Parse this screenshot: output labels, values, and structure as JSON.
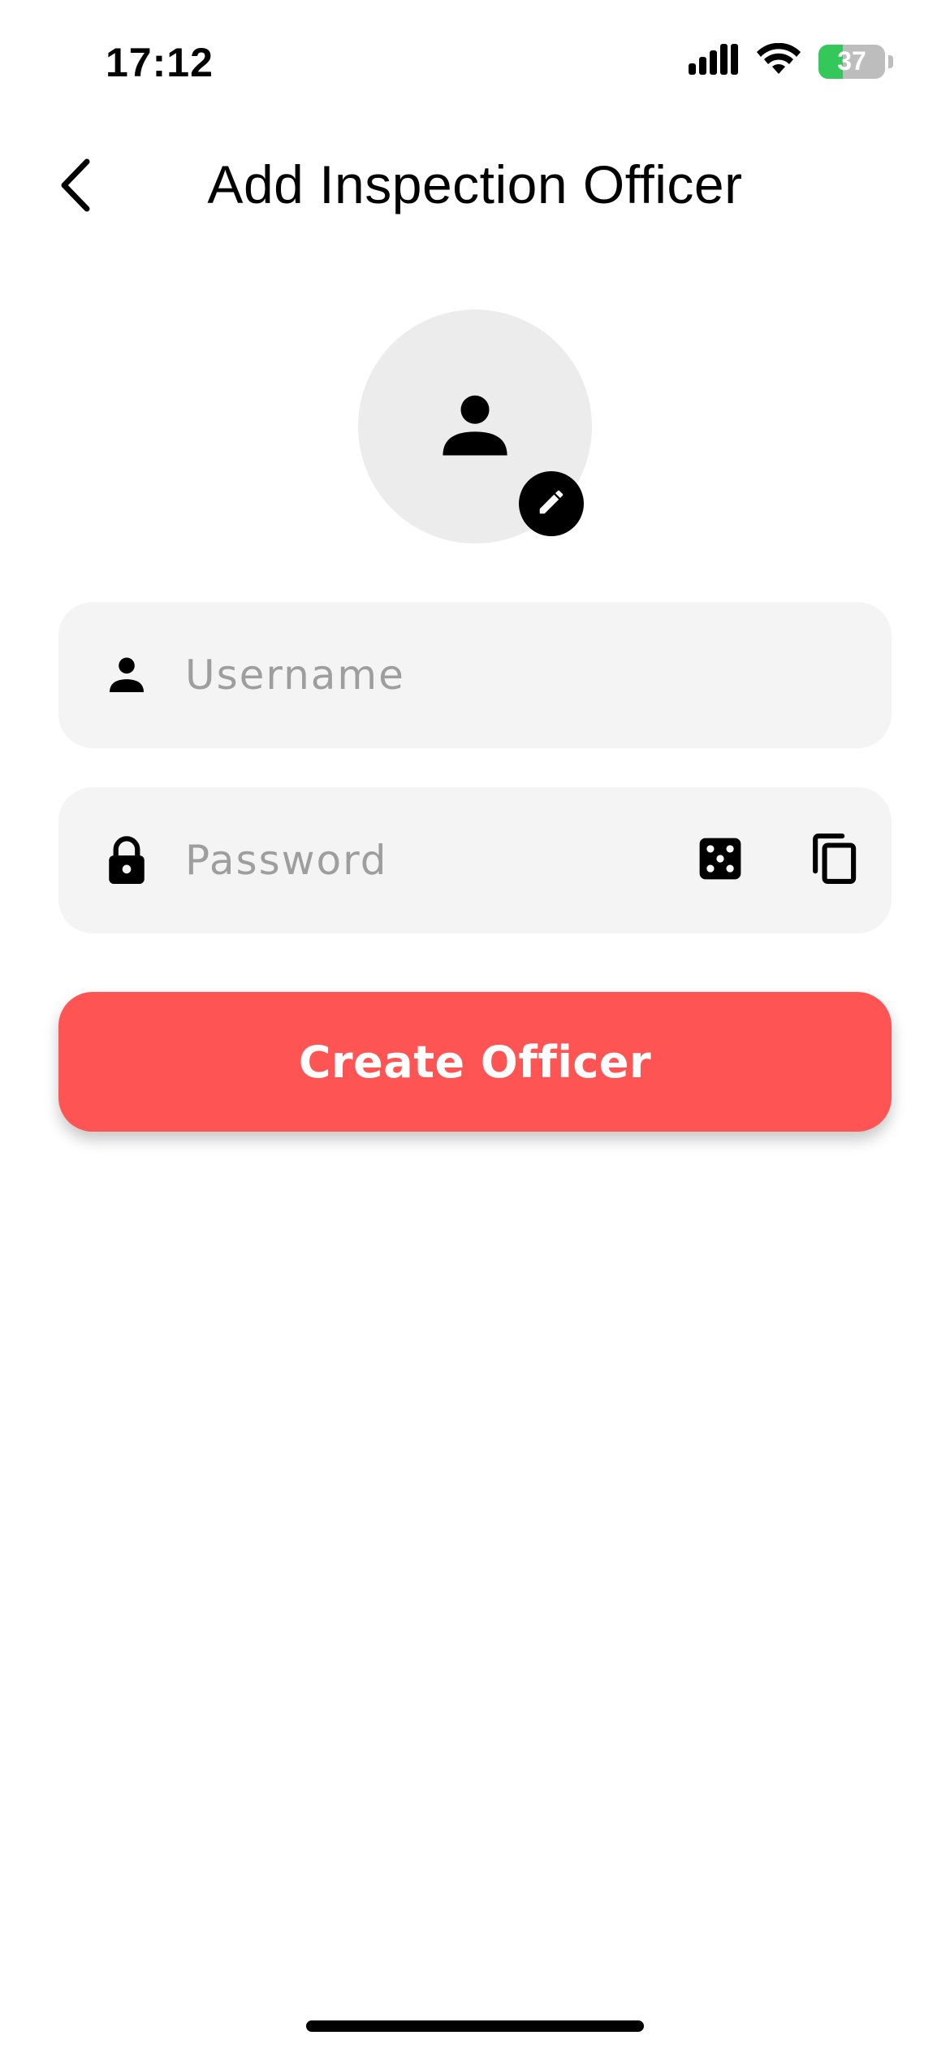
{
  "status_bar": {
    "time": "17:12",
    "battery_level": "37",
    "battery_fraction": 0.37,
    "icons": [
      "cellular-signal-icon",
      "wifi-icon",
      "battery-charging-icon"
    ]
  },
  "header": {
    "title": "Add Inspection Officer",
    "back_icon": "chevron-left-icon"
  },
  "avatar": {
    "icon": "person-icon",
    "edit_icon": "pencil-icon"
  },
  "form": {
    "username": {
      "placeholder": "Username",
      "value": "",
      "icon": "person-icon"
    },
    "password": {
      "placeholder": "Password",
      "value": "",
      "icon": "lock-icon",
      "generate_icon": "dice-icon",
      "copy_icon": "copy-icon"
    }
  },
  "actions": {
    "create_label": "Create Officer"
  },
  "colors": {
    "accent": "#ff5454",
    "field_background": "#f4f4f4",
    "avatar_background": "#ececec",
    "battery_green": "#34c759"
  }
}
